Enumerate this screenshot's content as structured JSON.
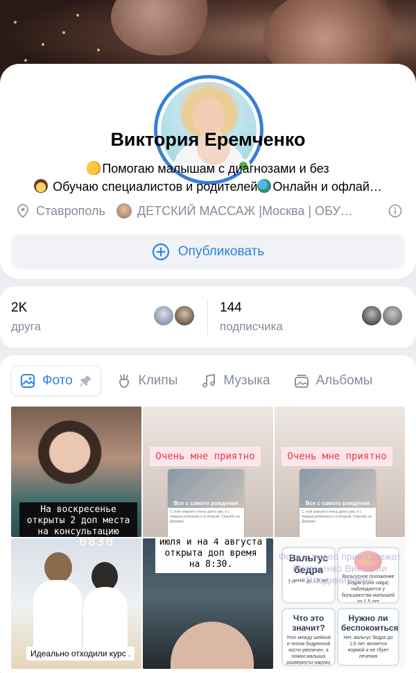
{
  "profile": {
    "name": "Виктория Еремченко",
    "status_line1": "Помогаю малышам с диагнозами и без",
    "status_line2": "Обучаю специалистов и родителей",
    "status_line2_tail": "Онлайн и офлай…",
    "city": "Ставрополь",
    "work": "ДЕТСКИЙ МАССАЖ |Москва  | ОБУ…",
    "publish_label": "Опубликовать",
    "online": true,
    "accent_color": "#2d81e0"
  },
  "stats": {
    "friends_count": "2K",
    "friends_label": "друга",
    "subscribers_count": "144",
    "subscribers_label": "подписчика"
  },
  "tabs": [
    {
      "label": "Фото",
      "icon": "photo-icon",
      "active": true,
      "pinned": true
    },
    {
      "label": "Клипы",
      "icon": "clips-icon"
    },
    {
      "label": "Музыка",
      "icon": "music-icon"
    },
    {
      "label": "Альбомы",
      "icon": "albums-icon"
    }
  ],
  "photos": {
    "p1_caption": "На воскресенье открыты 2 доп места на консультацию",
    "p2_banner": "Очень мне приятно",
    "p3_banner": "Очень мне приятно",
    "story_title": "Все с самого рождения",
    "story_text": "С этой семьей я очень долго уже, и с первым ребенком и со вторым. Спасибо за Доверие",
    "p4_clock": "0830",
    "p4_caption": "Идеально отходили курс .",
    "p5_caption": "июля и на 4 августа открыта доп время на 8:30.",
    "p6_box1_title": "Вальгус бедра",
    "p6_box1_sub": "у детей до 1,5 лет",
    "p6_box2_sub": "Вальгусное положение бедра (coxa valga) наблюдается у большинства малышей до 1,5 лет",
    "p6_box3_title": "Что это значит?",
    "p6_box3_sub": "Угол между шейкой и телом бедренной кости увеличен, а ножки малыша развёрнуты наружу",
    "p6_box4_title": "Нужно ли беспокоиться?",
    "p6_box4_sub": "Нет, вальгус бедра до 1,5 лет является нормой и не тбует лечения",
    "p6_watermark": "Фото и видео принадлежат Еремченко Виктории Владимировне"
  }
}
